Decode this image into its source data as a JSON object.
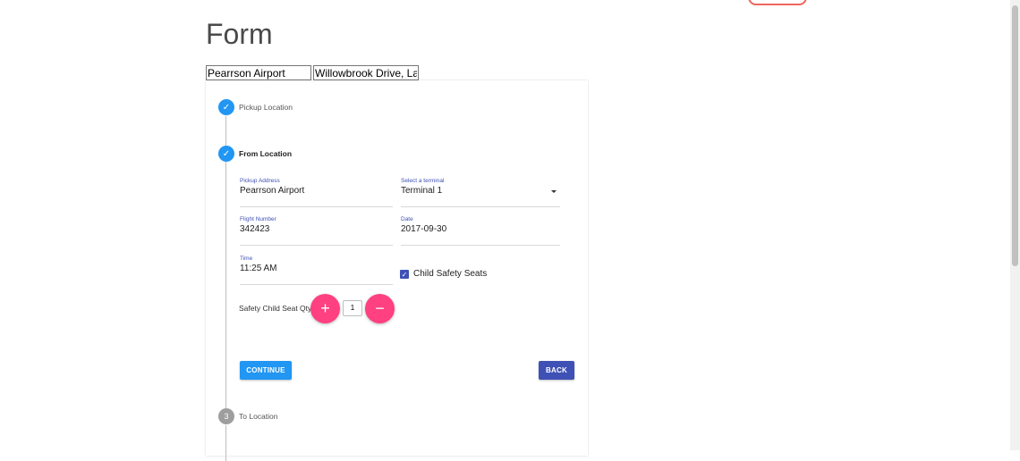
{
  "page": {
    "title": "Form"
  },
  "top_inputs": {
    "pickup_value": "Pearrson Airport",
    "dropoff_value": "Willowbrook Drive, Langley,"
  },
  "steps": [
    {
      "label": "Pickup Location",
      "icon": "check-icon",
      "status": "done"
    },
    {
      "label": "From Location",
      "icon": "check-icon",
      "status": "active"
    },
    {
      "label": "To Location",
      "number": "3",
      "status": "todo"
    }
  ],
  "form": {
    "pickup_address": {
      "label": "Pickup Address",
      "value": "Pearrson Airport"
    },
    "terminal": {
      "label": "Select a terminal",
      "value": "Terminal 1"
    },
    "flight_number": {
      "label": "Flight Number",
      "value": "342423"
    },
    "date": {
      "label": "Date",
      "value": "2017-09-30"
    },
    "time": {
      "label": "Time",
      "value": "11:25 AM"
    },
    "child_safety_seats": {
      "label": "Child Safety Seats",
      "checked": true
    },
    "seat_qty": {
      "label": "Safety Child Seat Qty",
      "value": "1",
      "plus": "+",
      "minus": "−"
    }
  },
  "buttons": {
    "continue": "CONTINUE",
    "back": "BACK"
  },
  "colors": {
    "primary": "#2196f3",
    "indigo": "#3f51b5",
    "accent": "#ff4081"
  }
}
